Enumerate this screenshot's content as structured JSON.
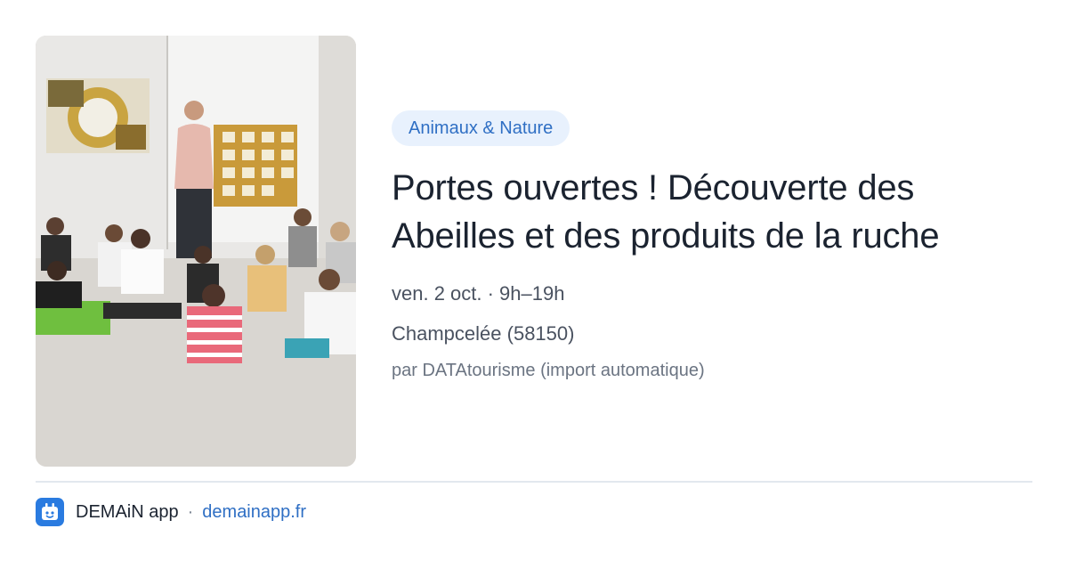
{
  "event": {
    "category": "Animaux & Nature",
    "title": "Portes ouvertes ! Découverte des Abeilles et des produits de la ruche",
    "date": "ven. 2 oct. · 9h–19h",
    "location": "Champcelée (58150)",
    "source": "par DATAtourisme (import automatique)"
  },
  "footer": {
    "app_name": "DEMAiN app",
    "separator": "·",
    "domain": "demainapp.fr"
  },
  "colors": {
    "accent": "#2f6fc4",
    "pill_background": "#e8f1fd",
    "title": "#1b2330",
    "logo": "#2a7be0"
  },
  "icons": {
    "app_logo": "calendar-app-icon"
  }
}
